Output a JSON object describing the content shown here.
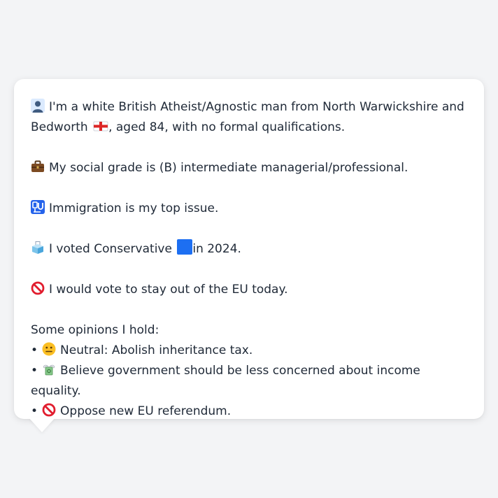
{
  "profile": {
    "intro": {
      "icon": "person-silhouette-icon",
      "text_before_flag": "I'm a white British Atheist/Agnostic man from North Warwickshire and Bedworth",
      "flag_icon": "england-flag-icon",
      "text_after_flag": ", aged 84, with no formal qualifications."
    },
    "social_grade": {
      "icon": "briefcase-icon",
      "text": "My social grade is (B) intermediate managerial/professional."
    },
    "top_issue": {
      "icon": "passport-control-icon",
      "text": "Immigration is my top issue."
    },
    "vote": {
      "icon": "ballot-box-icon",
      "text_before_icon": "I voted Conservative",
      "party_icon": "blue-square-icon",
      "text_after_icon": "in 2024."
    },
    "eu": {
      "icon": "prohibited-icon",
      "text": "I would vote to stay out of the EU today."
    }
  },
  "opinions": {
    "heading": "Some opinions I hold:",
    "bullet": "•",
    "items": [
      {
        "icon": "neutral-face-icon",
        "text": "Neutral: Abolish inheritance tax."
      },
      {
        "icon": "money-wings-icon",
        "text": "Believe government should be less concerned about income equality."
      },
      {
        "icon": "prohibited-icon",
        "text": "Oppose new EU referendum."
      }
    ]
  },
  "colors": {
    "background": "#f3f4f6",
    "card": "#ffffff",
    "text": "#1f2937",
    "conservative_blue": "#1d6ff2"
  }
}
